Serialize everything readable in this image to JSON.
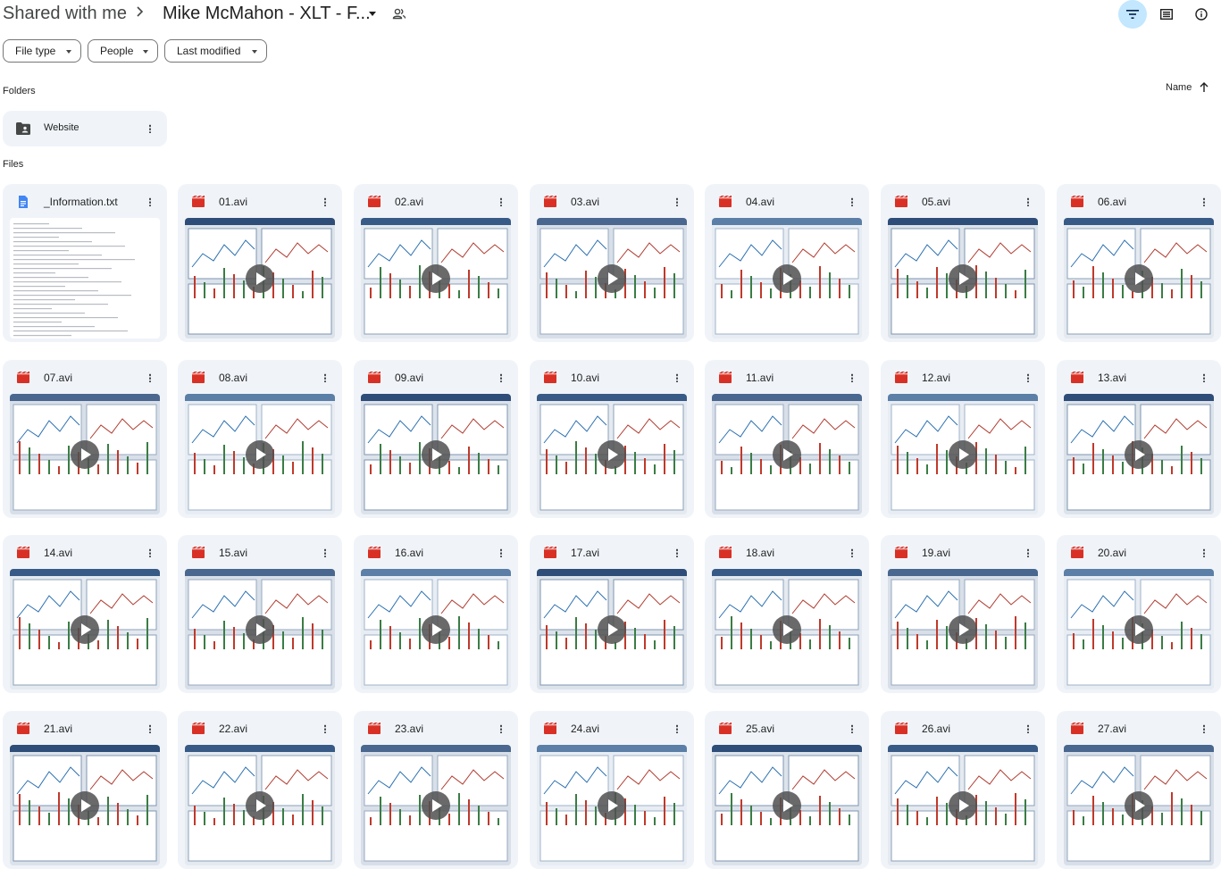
{
  "breadcrumb": {
    "root": "Shared with me",
    "current": "Mike McMahon - XLT - F..."
  },
  "toolbar": {
    "filter_icon": "filter-icon",
    "list_view_icon": "list-view-icon",
    "info_icon": "info-icon"
  },
  "filters": [
    {
      "label": "File type"
    },
    {
      "label": "People"
    },
    {
      "label": "Last modified"
    }
  ],
  "sections": {
    "folders_label": "Folders",
    "files_label": "Files"
  },
  "sort": {
    "label": "Name",
    "direction": "ascending"
  },
  "folders": [
    {
      "name": "Website",
      "icon": "shared-folder-icon"
    }
  ],
  "files": [
    {
      "name": "_Information.txt",
      "type": "text"
    },
    {
      "name": "01.avi",
      "type": "video"
    },
    {
      "name": "02.avi",
      "type": "video"
    },
    {
      "name": "03.avi",
      "type": "video"
    },
    {
      "name": "04.avi",
      "type": "video"
    },
    {
      "name": "05.avi",
      "type": "video"
    },
    {
      "name": "06.avi",
      "type": "video"
    },
    {
      "name": "07.avi",
      "type": "video"
    },
    {
      "name": "08.avi",
      "type": "video"
    },
    {
      "name": "09.avi",
      "type": "video"
    },
    {
      "name": "10.avi",
      "type": "video"
    },
    {
      "name": "11.avi",
      "type": "video"
    },
    {
      "name": "12.avi",
      "type": "video"
    },
    {
      "name": "13.avi",
      "type": "video"
    },
    {
      "name": "14.avi",
      "type": "video"
    },
    {
      "name": "15.avi",
      "type": "video"
    },
    {
      "name": "16.avi",
      "type": "video"
    },
    {
      "name": "17.avi",
      "type": "video"
    },
    {
      "name": "18.avi",
      "type": "video"
    },
    {
      "name": "19.avi",
      "type": "video"
    },
    {
      "name": "20.avi",
      "type": "video"
    },
    {
      "name": "21.avi",
      "type": "video"
    },
    {
      "name": "22.avi",
      "type": "video"
    },
    {
      "name": "23.avi",
      "type": "video"
    },
    {
      "name": "24.avi",
      "type": "video"
    },
    {
      "name": "25.avi",
      "type": "video"
    },
    {
      "name": "26.avi",
      "type": "video"
    },
    {
      "name": "27.avi",
      "type": "video"
    }
  ],
  "colors": {
    "card_bg": "#f0f4f9",
    "active_toggle": "#c2e7ff",
    "video_icon": "#d93025",
    "doc_icon": "#4285f4"
  }
}
